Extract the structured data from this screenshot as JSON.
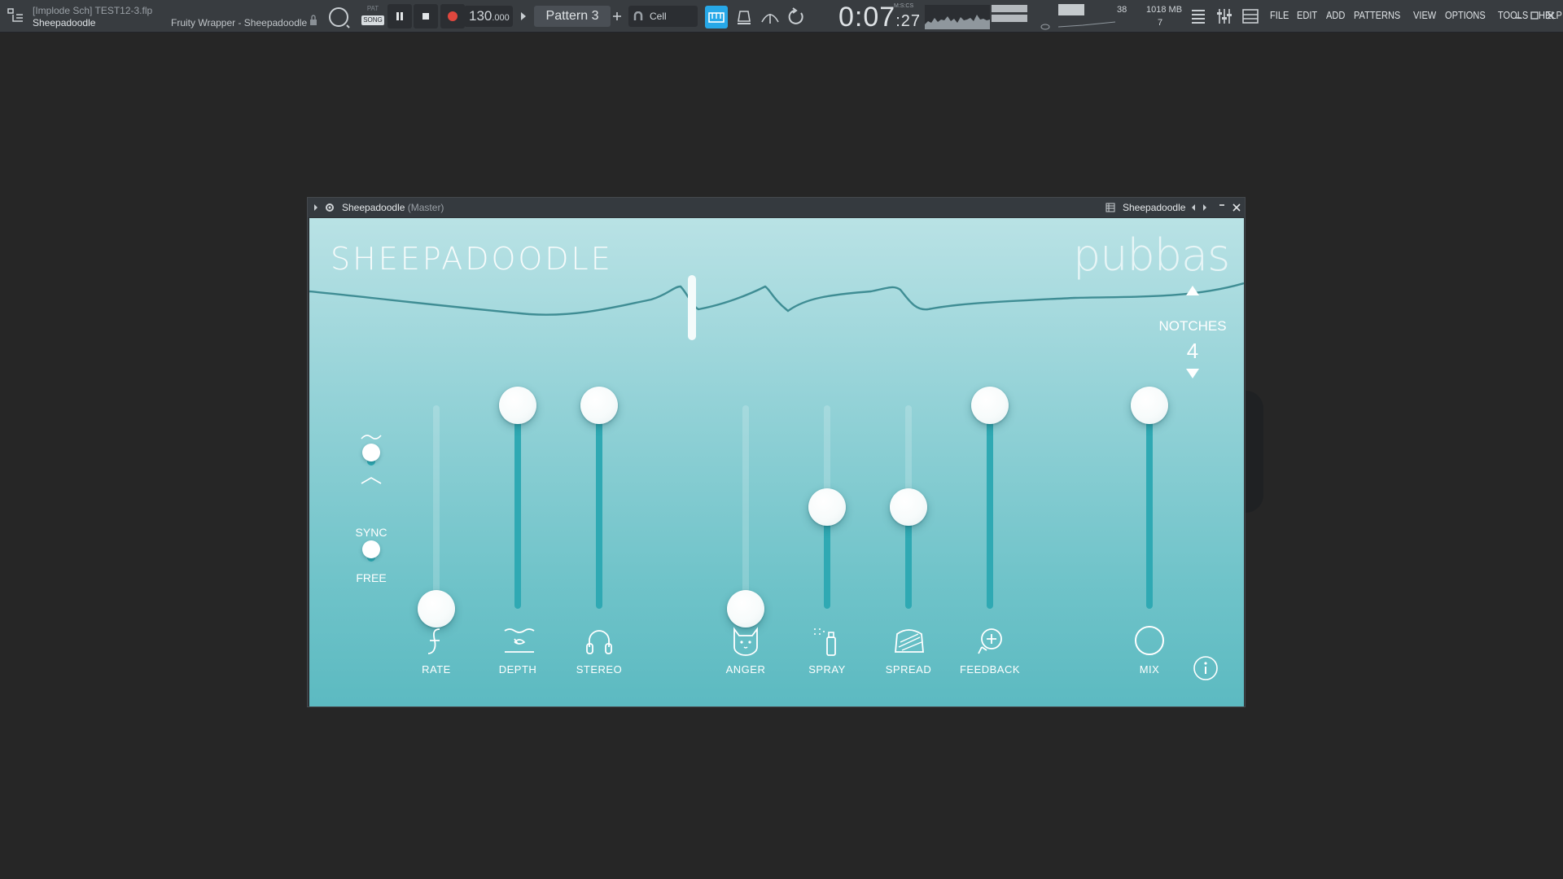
{
  "toolbar": {
    "project_line1": "[Implode Sch] TEST12-3.flp",
    "project_line2": "Sheepadoodle",
    "focus_name": "Fruity Wrapper - Sheepadoodle",
    "pat_label": "PAT",
    "song_label": "SONG",
    "tempo": "130",
    "tempo_fraction": ".000",
    "pattern": "Pattern 3",
    "snap": "Cell",
    "time_main": "0:07",
    "time_sub": ":27",
    "time_unit": "M:S:CS",
    "cpu": "38",
    "memory": "1018 MB",
    "polyphony": "7",
    "menus": [
      "FILE",
      "EDIT",
      "ADD",
      "PATTERNS",
      "VIEW",
      "OPTIONS",
      "TOOLS",
      "HELP"
    ]
  },
  "plugin": {
    "title": "Sheepadoodle",
    "title_suffix": "(Master)",
    "preset_name": "Sheepadoodle",
    "brand_title": "SHEEPADOODLE",
    "brand_logo": "pubbas",
    "notches_label": "NOTCHES",
    "notches_value": "4",
    "sync_label": "SYNC",
    "free_label": "FREE",
    "faders": [
      {
        "label": "RATE",
        "value": 0.0,
        "icon": "rate-icon"
      },
      {
        "label": "DEPTH",
        "value": 1.0,
        "icon": "depth-icon"
      },
      {
        "label": "STEREO",
        "value": 1.0,
        "icon": "headphones-icon"
      },
      {
        "label": "ANGER",
        "value": 0.0,
        "icon": "cat-icon"
      },
      {
        "label": "SPRAY",
        "value": 0.5,
        "icon": "spray-icon"
      },
      {
        "label": "SPREAD",
        "value": 0.5,
        "icon": "spread-icon"
      },
      {
        "label": "FEEDBACK",
        "value": 1.0,
        "icon": "feedback-icon"
      },
      {
        "label": "MIX",
        "value": 1.0,
        "icon": "circle-icon"
      }
    ],
    "accent_color": "#2fa9b3"
  }
}
